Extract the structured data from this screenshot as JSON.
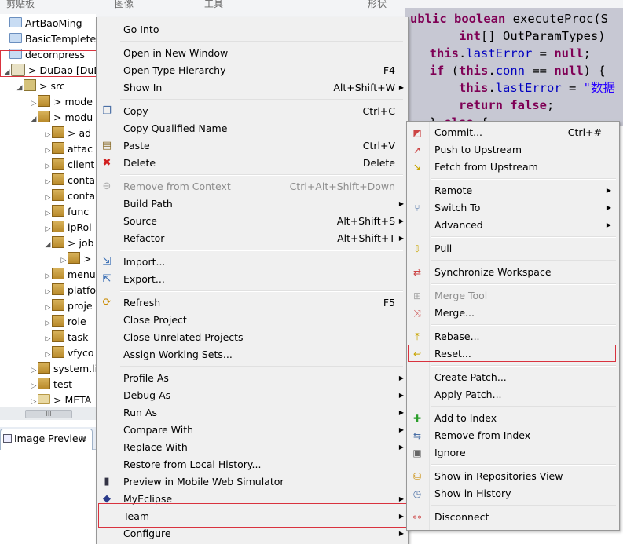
{
  "top_strip": {
    "labels": [
      "剪贴板",
      "图像",
      "工具",
      "形状"
    ]
  },
  "explorer": {
    "rows": [
      {
        "label": "ArtBaoMing",
        "icon": "folder-icon"
      },
      {
        "label": "BasicTemplete",
        "icon": "folder-icon"
      },
      {
        "label": "decompress",
        "icon": "folder-icon"
      },
      {
        "label": "> DuDao  [DuDao",
        "icon": "project-icon"
      },
      {
        "label": "> src",
        "icon": "source-folder-icon"
      },
      {
        "label": "> mode",
        "icon": "package-icon"
      },
      {
        "label": "> modu",
        "icon": "package-icon"
      },
      {
        "label": "> ad",
        "icon": "package-icon"
      },
      {
        "label": "attac",
        "icon": "package-icon"
      },
      {
        "label": "client",
        "icon": "package-icon"
      },
      {
        "label": "conta",
        "icon": "package-icon"
      },
      {
        "label": "conta",
        "icon": "package-icon"
      },
      {
        "label": "func",
        "icon": "package-icon"
      },
      {
        "label": "ipRol",
        "icon": "package-icon"
      },
      {
        "label": "> job",
        "icon": "package-icon"
      },
      {
        "label": ">",
        "icon": "java-file-icon"
      },
      {
        "label": "menu",
        "icon": "package-icon"
      },
      {
        "label": "platfo",
        "icon": "package-icon"
      },
      {
        "label": "proje",
        "icon": "package-icon"
      },
      {
        "label": "role",
        "icon": "package-icon"
      },
      {
        "label": "task",
        "icon": "package-icon"
      },
      {
        "label": "vfyco",
        "icon": "package-icon"
      },
      {
        "label": "system.li",
        "icon": "package-icon"
      },
      {
        "label": "test",
        "icon": "package-icon"
      },
      {
        "label": "> META",
        "icon": "folder-icon"
      }
    ],
    "scrollbar_thumb": "III",
    "view_tab": "Image Preview",
    "view_tab_close": "✕"
  },
  "editor": {
    "lines": [
      "ublic boolean executeProc(S",
      "      int[] OutParamTypes) ",
      "  this.lastError = null;",
      "  if (this.conn == null) {",
      "      this.lastError = \"数据",
      "      return false;",
      "  } else {"
    ],
    "right_edge_chars": [
      "s",
      "s",
      "",
      "",
      "r",
      ".",
      "",
      "",
      "e",
      "n",
      "j",
      "",
      "",
      "",
      "",
      "",
      "",
      "t"
    ]
  },
  "menu": {
    "items": [
      {
        "label": "Go Into",
        "accel": "",
        "submenu": false,
        "disabled": false,
        "icon": ""
      },
      {
        "sep": true
      },
      {
        "label": "Open in New Window",
        "accel": "",
        "submenu": false,
        "disabled": false,
        "icon": ""
      },
      {
        "label": "Open Type Hierarchy",
        "accel": "F4",
        "submenu": false,
        "disabled": false,
        "icon": ""
      },
      {
        "label": "Show In",
        "accel": "Alt+Shift+W",
        "submenu": true,
        "disabled": false,
        "icon": ""
      },
      {
        "sep": true
      },
      {
        "label": "Copy",
        "accel": "Ctrl+C",
        "submenu": false,
        "disabled": false,
        "icon": "copy-icon"
      },
      {
        "label": "Copy Qualified Name",
        "accel": "",
        "submenu": false,
        "disabled": false,
        "icon": ""
      },
      {
        "label": "Paste",
        "accel": "Ctrl+V",
        "submenu": false,
        "disabled": false,
        "icon": "paste-icon"
      },
      {
        "label": "Delete",
        "accel": "Delete",
        "submenu": false,
        "disabled": false,
        "icon": "delete-icon"
      },
      {
        "sep": true
      },
      {
        "label": "Remove from Context",
        "accel": "Ctrl+Alt+Shift+Down",
        "submenu": false,
        "disabled": true,
        "icon": "remove-context-icon"
      },
      {
        "label": "Build Path",
        "accel": "",
        "submenu": true,
        "disabled": false,
        "icon": ""
      },
      {
        "label": "Source",
        "accel": "Alt+Shift+S",
        "submenu": true,
        "disabled": false,
        "icon": ""
      },
      {
        "label": "Refactor",
        "accel": "Alt+Shift+T",
        "submenu": true,
        "disabled": false,
        "icon": ""
      },
      {
        "sep": true
      },
      {
        "label": "Import...",
        "accel": "",
        "submenu": false,
        "disabled": false,
        "icon": "import-icon"
      },
      {
        "label": "Export...",
        "accel": "",
        "submenu": false,
        "disabled": false,
        "icon": "export-icon"
      },
      {
        "sep": true
      },
      {
        "label": "Refresh",
        "accel": "F5",
        "submenu": false,
        "disabled": false,
        "icon": "refresh-icon"
      },
      {
        "label": "Close Project",
        "accel": "",
        "submenu": false,
        "disabled": false,
        "icon": ""
      },
      {
        "label": "Close Unrelated Projects",
        "accel": "",
        "submenu": false,
        "disabled": false,
        "icon": ""
      },
      {
        "label": "Assign Working Sets...",
        "accel": "",
        "submenu": false,
        "disabled": false,
        "icon": ""
      },
      {
        "sep": true
      },
      {
        "label": "Profile As",
        "accel": "",
        "submenu": true,
        "disabled": false,
        "icon": ""
      },
      {
        "label": "Debug As",
        "accel": "",
        "submenu": true,
        "disabled": false,
        "icon": ""
      },
      {
        "label": "Run As",
        "accel": "",
        "submenu": true,
        "disabled": false,
        "icon": ""
      },
      {
        "label": "Compare With",
        "accel": "",
        "submenu": true,
        "disabled": false,
        "icon": ""
      },
      {
        "label": "Replace With",
        "accel": "",
        "submenu": true,
        "disabled": false,
        "icon": ""
      },
      {
        "label": "Restore from Local History...",
        "accel": "",
        "submenu": false,
        "disabled": false,
        "icon": ""
      },
      {
        "label": "Preview in Mobile Web Simulator",
        "accel": "",
        "submenu": false,
        "disabled": false,
        "icon": "mobile-icon"
      },
      {
        "label": "MyEclipse",
        "accel": "",
        "submenu": true,
        "disabled": false,
        "icon": "myeclipse-icon"
      },
      {
        "label": "Team",
        "accel": "",
        "submenu": true,
        "disabled": false,
        "icon": ""
      },
      {
        "label": "Configure",
        "accel": "",
        "submenu": true,
        "disabled": false,
        "icon": ""
      }
    ]
  },
  "team_menu": {
    "items": [
      {
        "label": "Commit...",
        "accel": "Ctrl+#",
        "submenu": false,
        "disabled": false,
        "icon": "commit-icon"
      },
      {
        "label": "Push to Upstream",
        "accel": "",
        "submenu": false,
        "disabled": false,
        "icon": "push-icon"
      },
      {
        "label": "Fetch from Upstream",
        "accel": "",
        "submenu": false,
        "disabled": false,
        "icon": "fetch-icon"
      },
      {
        "sep": true
      },
      {
        "label": "Remote",
        "accel": "",
        "submenu": true,
        "disabled": false,
        "icon": ""
      },
      {
        "label": "Switch To",
        "accel": "",
        "submenu": true,
        "disabled": false,
        "icon": "branch-icon"
      },
      {
        "label": "Advanced",
        "accel": "",
        "submenu": true,
        "disabled": false,
        "icon": ""
      },
      {
        "sep": true
      },
      {
        "label": "Pull",
        "accel": "",
        "submenu": false,
        "disabled": false,
        "icon": "pull-icon"
      },
      {
        "sep": true
      },
      {
        "label": "Synchronize Workspace",
        "accel": "",
        "submenu": false,
        "disabled": false,
        "icon": "synchronize-icon"
      },
      {
        "sep": true
      },
      {
        "label": "Merge Tool",
        "accel": "",
        "submenu": false,
        "disabled": true,
        "icon": "merge-tool-icon"
      },
      {
        "label": "Merge...",
        "accel": "",
        "submenu": false,
        "disabled": false,
        "icon": "merge-icon"
      },
      {
        "sep": true
      },
      {
        "label": "Rebase...",
        "accel": "",
        "submenu": false,
        "disabled": false,
        "icon": "rebase-icon"
      },
      {
        "label": "Reset...",
        "accel": "",
        "submenu": false,
        "disabled": false,
        "icon": "reset-icon"
      },
      {
        "sep": true
      },
      {
        "label": "Create Patch...",
        "accel": "",
        "submenu": false,
        "disabled": false,
        "icon": ""
      },
      {
        "label": "Apply Patch...",
        "accel": "",
        "submenu": false,
        "disabled": false,
        "icon": ""
      },
      {
        "sep": true
      },
      {
        "label": "Add to Index",
        "accel": "",
        "submenu": false,
        "disabled": false,
        "icon": "add-index-icon"
      },
      {
        "label": "Remove from Index",
        "accel": "",
        "submenu": false,
        "disabled": false,
        "icon": "remove-index-icon"
      },
      {
        "label": "Ignore",
        "accel": "",
        "submenu": false,
        "disabled": false,
        "icon": "ignore-icon"
      },
      {
        "sep": true
      },
      {
        "label": "Show in Repositories View",
        "accel": "",
        "submenu": false,
        "disabled": false,
        "icon": "repositories-icon"
      },
      {
        "label": "Show in History",
        "accel": "",
        "submenu": false,
        "disabled": false,
        "icon": "history-icon"
      },
      {
        "sep": true
      },
      {
        "label": "Disconnect",
        "accel": "",
        "submenu": false,
        "disabled": false,
        "icon": "disconnect-icon"
      }
    ]
  },
  "colors": {
    "highlight_border": "#d9323e",
    "menu_bg": "#f0f0f0",
    "editor_bg": "#c7c8d3"
  }
}
